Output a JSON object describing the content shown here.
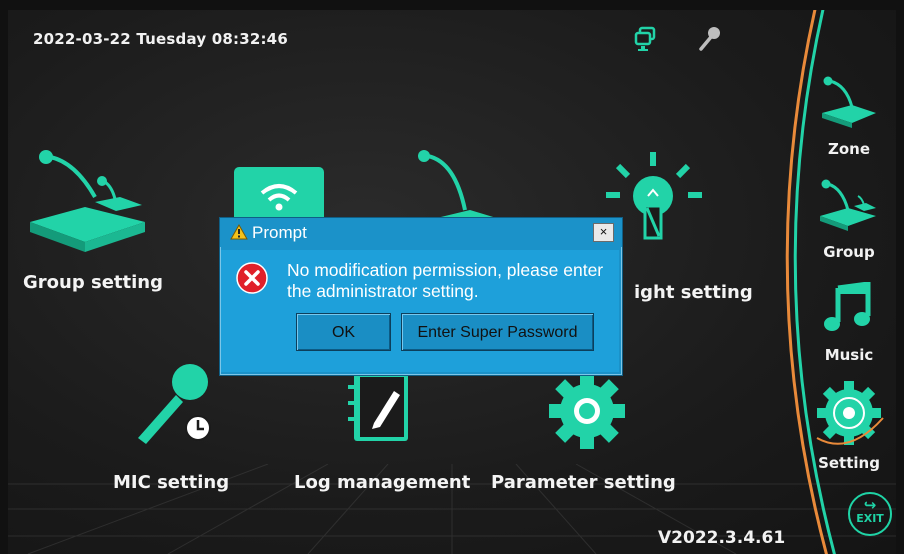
{
  "status_bar": {
    "datetime": "2022-03-22 Tuesday 08:32:46",
    "icons": [
      "monitor-icon",
      "microphone-icon"
    ]
  },
  "tiles": [
    {
      "label": "Group setting",
      "icon": "conference-mic-group-icon"
    },
    {
      "label": "",
      "icon": "wifi-icon"
    },
    {
      "label": "",
      "icon": "conference-mic-icon"
    },
    {
      "label": "ight setting",
      "icon": "light-bulb-icon"
    },
    {
      "label": "MIC setting",
      "icon": "handheld-mic-icon"
    },
    {
      "label": "Log management",
      "icon": "notebook-icon"
    },
    {
      "label": "Parameter setting",
      "icon": "gear-icon"
    }
  ],
  "sidebar": {
    "items": [
      {
        "label": "Zone",
        "icon": "conference-mic-icon"
      },
      {
        "label": "Group",
        "icon": "conference-mic-group-icon"
      },
      {
        "label": "Music",
        "icon": "music-note-icon"
      },
      {
        "label": "Setting",
        "icon": "gear-icon",
        "active": true
      }
    ],
    "exit_label": "EXIT"
  },
  "version": "V2022.3.4.61",
  "dialog": {
    "title": "Prompt",
    "close_label": "×",
    "message": "No modification permission, please enter the administrator setting.",
    "buttons": {
      "ok": "OK",
      "super": "Enter Super Password"
    }
  },
  "colors": {
    "accent": "#22d3a8",
    "dialog_blue": "#1ea0da",
    "arc_orange": "#e98a3a"
  }
}
